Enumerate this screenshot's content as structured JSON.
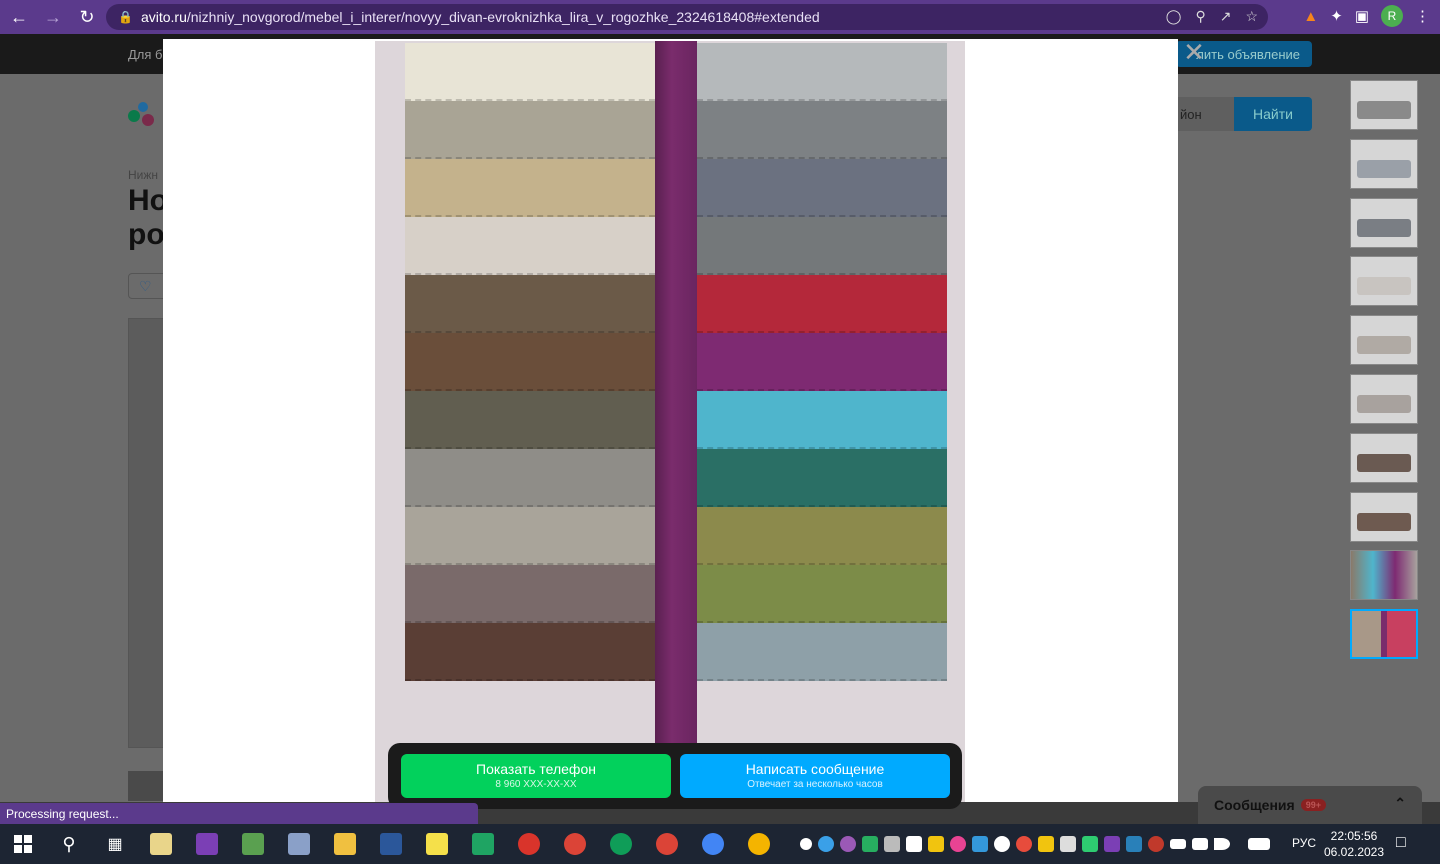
{
  "browser": {
    "url_host": "avito.ru",
    "url_path": "/nizhniy_novgorod/mebel_i_interer/novyy_divan-evroknizhka_lira_v_rogozhke_2324618408#extended",
    "profile_initial": "R",
    "colors": {
      "frame": "#5b3a8c",
      "omnibox": "#3d2463"
    }
  },
  "background_page": {
    "topbar_left": "Для б",
    "post_ad_button": "лить объявление",
    "breadcrumb": "Нижн",
    "title_line1": "Но",
    "title_line2": "ро",
    "region_select": "йон",
    "find_button": "Найти"
  },
  "gallery": {
    "thumbnails_count": 10,
    "active_thumbnail": 10,
    "left_swatches": [
      "#e8e4d6",
      "#a9a495",
      "#c4b28c",
      "#d7d0c8",
      "#6b5a48",
      "#6a4e3a",
      "#615e50",
      "#8f8d88",
      "#a9a49a",
      "#7a6a6a",
      "#5a3e35"
    ],
    "right_swatches": [
      "#b5b9bb",
      "#7d8184",
      "#6b7180",
      "#74787a",
      "#b4283a",
      "#7e2a72",
      "#4fb5cc",
      "#2a6f65",
      "#8c8a4c",
      "#7c8c48",
      "#8ea0a8"
    ]
  },
  "contact": {
    "phone_button": "Показать телефон",
    "phone_number": "8 960 XXX-XX-XX",
    "message_button": "Написать сообщение",
    "message_sub": "Отвечает за несколько часов"
  },
  "messages_widget": {
    "label": "Сообщения",
    "badge": "99+"
  },
  "status_bar": "Processing request...",
  "taskbar": {
    "language": "РУС",
    "time": "22:05:56",
    "date": "06.02.2023"
  }
}
